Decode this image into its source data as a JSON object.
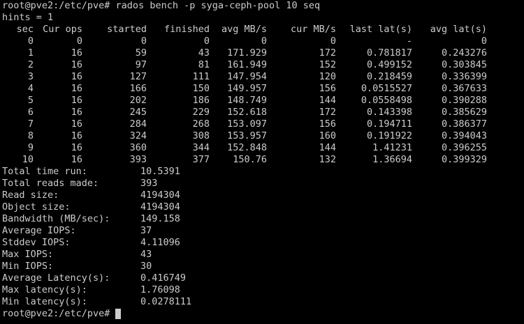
{
  "command_line": "root@pve2:/etc/pve# rados bench -p syga-ceph-pool 10 seq",
  "hints_line": "hints = 1",
  "bench_table": {
    "headers": [
      "sec",
      "Cur ops",
      "started",
      "finished",
      "avg MB/s",
      "cur MB/s",
      "last lat(s)",
      "avg lat(s)"
    ],
    "rows": [
      [
        "0",
        "0",
        "0",
        "0",
        "0",
        "0",
        "-",
        "0"
      ],
      [
        "1",
        "16",
        "59",
        "43",
        "171.929",
        "172",
        "0.781817",
        "0.243276"
      ],
      [
        "2",
        "16",
        "97",
        "81",
        "161.949",
        "152",
        "0.499152",
        "0.303845"
      ],
      [
        "3",
        "16",
        "127",
        "111",
        "147.954",
        "120",
        "0.218459",
        "0.336399"
      ],
      [
        "4",
        "16",
        "166",
        "150",
        "149.957",
        "156",
        "0.0515527",
        "0.367633"
      ],
      [
        "5",
        "16",
        "202",
        "186",
        "148.749",
        "144",
        "0.0558498",
        "0.390288"
      ],
      [
        "6",
        "16",
        "245",
        "229",
        "152.618",
        "172",
        "0.143398",
        "0.385629"
      ],
      [
        "7",
        "16",
        "284",
        "268",
        "153.097",
        "156",
        "0.194711",
        "0.386377"
      ],
      [
        "8",
        "16",
        "324",
        "308",
        "153.957",
        "160",
        "0.191922",
        "0.394043"
      ],
      [
        "9",
        "16",
        "360",
        "344",
        "152.848",
        "144",
        "1.41231",
        "0.396255"
      ],
      [
        "10",
        "16",
        "393",
        "377",
        "150.76",
        "132",
        "1.36694",
        "0.399329"
      ]
    ]
  },
  "summary": [
    {
      "label": "Total time run:",
      "value": "10.5391"
    },
    {
      "label": "Total reads made:",
      "value": "393"
    },
    {
      "label": "Read size:",
      "value": "4194304"
    },
    {
      "label": "Object size:",
      "value": "4194304"
    },
    {
      "label": "Bandwidth (MB/sec):",
      "value": "149.158"
    },
    {
      "label": "Average IOPS:",
      "value": "37"
    },
    {
      "label": "Stddev IOPS:",
      "value": "4.11096"
    },
    {
      "label": "Max IOPS:",
      "value": "43"
    },
    {
      "label": "Min IOPS:",
      "value": "30"
    },
    {
      "label": "Average Latency(s):",
      "value": "0.416749"
    },
    {
      "label": "Max latency(s):",
      "value": "1.76098"
    },
    {
      "label": "Min latency(s):",
      "value": "0.0278111"
    }
  ],
  "final_prompt": "root@pve2:/etc/pve#",
  "colors": {
    "background": "#000000",
    "foreground": "#cccccc"
  }
}
